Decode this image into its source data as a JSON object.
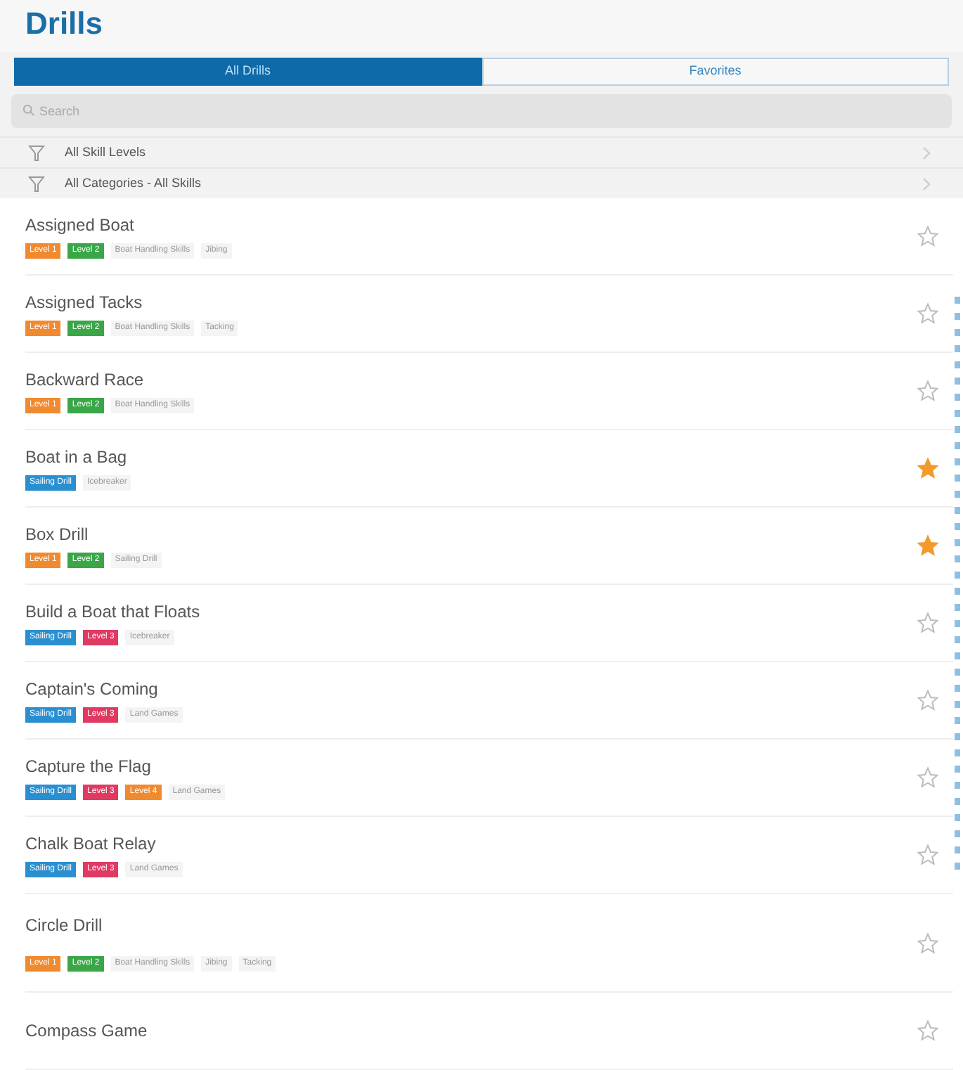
{
  "header": {
    "title": "Drills"
  },
  "tabs": [
    {
      "label": "All Drills",
      "selected": true
    },
    {
      "label": "Favorites",
      "selected": false
    }
  ],
  "search": {
    "placeholder": "Search"
  },
  "filters": [
    {
      "label": "All Skill Levels"
    },
    {
      "label": "All Categories - All Skills"
    }
  ],
  "drills": [
    {
      "name": "Assigned Boat",
      "favorite": false,
      "tags": [
        {
          "label": "Level 1",
          "color": "#f08a30"
        },
        {
          "label": "Level 2",
          "color": "#3aa648"
        },
        {
          "label": "Boat Handling Skills"
        },
        {
          "label": "Jibing"
        }
      ]
    },
    {
      "name": "Assigned Tacks",
      "favorite": false,
      "tags": [
        {
          "label": "Level 1",
          "color": "#f08a30"
        },
        {
          "label": "Level 2",
          "color": "#3aa648"
        },
        {
          "label": "Boat Handling Skills"
        },
        {
          "label": "Tacking"
        }
      ]
    },
    {
      "name": "Backward Race",
      "favorite": false,
      "tags": [
        {
          "label": "Level 1",
          "color": "#f08a30"
        },
        {
          "label": "Level 2",
          "color": "#3aa648"
        },
        {
          "label": "Boat Handling Skills"
        }
      ]
    },
    {
      "name": "Boat in a Bag",
      "favorite": true,
      "tags": [
        {
          "label": "Sailing Drill",
          "color": "#2a8fd0"
        },
        {
          "label": "Icebreaker"
        }
      ]
    },
    {
      "name": "Box Drill",
      "favorite": true,
      "tags": [
        {
          "label": "Level 1",
          "color": "#f08a30"
        },
        {
          "label": "Level 2",
          "color": "#3aa648"
        },
        {
          "label": "Sailing Drill"
        }
      ]
    },
    {
      "name": "Build a Boat that Floats",
      "favorite": false,
      "tags": [
        {
          "label": "Sailing Drill",
          "color": "#2a8fd0"
        },
        {
          "label": "Level 3",
          "color": "#e03a62"
        },
        {
          "label": "Icebreaker"
        }
      ]
    },
    {
      "name": "Captain's Coming",
      "favorite": false,
      "tags": [
        {
          "label": "Sailing Drill",
          "color": "#2a8fd0"
        },
        {
          "label": "Level 3",
          "color": "#e03a62"
        },
        {
          "label": "Land Games"
        }
      ]
    },
    {
      "name": "Capture the Flag",
      "favorite": false,
      "tags": [
        {
          "label": "Sailing Drill",
          "color": "#2a8fd0"
        },
        {
          "label": "Level 3",
          "color": "#e03a62"
        },
        {
          "label": "Level 4",
          "color": "#f08a30"
        },
        {
          "label": "Land Games"
        }
      ]
    },
    {
      "name": "Chalk Boat Relay",
      "favorite": false,
      "tags": [
        {
          "label": "Sailing Drill",
          "color": "#2a8fd0"
        },
        {
          "label": "Level 3",
          "color": "#e03a62"
        },
        {
          "label": "Land Games"
        }
      ]
    },
    {
      "name": "Circle Drill",
      "favorite": false,
      "tags": [
        {
          "label": "Level 1",
          "color": "#f08a30"
        },
        {
          "label": "Level 2",
          "color": "#3aa648"
        },
        {
          "label": "Boat Handling Skills"
        },
        {
          "label": "Jibing"
        },
        {
          "label": "Tacking"
        }
      ]
    },
    {
      "name": "Compass Game",
      "favorite": false
    }
  ]
}
